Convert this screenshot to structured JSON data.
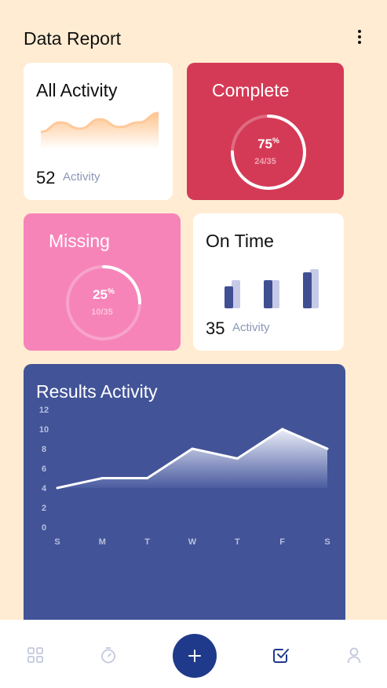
{
  "header": {
    "title": "Data Report",
    "menu_icon": "more-vertical-icon"
  },
  "all_activity": {
    "title": "All Activity",
    "count": "52",
    "count_label": "Activity",
    "sparkline": [
      0.3,
      0.6,
      0.4,
      0.7,
      0.45,
      0.6,
      0.9
    ]
  },
  "complete": {
    "title": "Complete",
    "percent": "75",
    "percent_sign": "%",
    "fraction": "24/35",
    "progress": 0.75,
    "color": "#d43a56"
  },
  "missing": {
    "title": "Missing",
    "percent": "25",
    "percent_sign": "%",
    "fraction": "10/35",
    "progress": 0.25,
    "color": "#f684b9"
  },
  "on_time": {
    "title": "On Time",
    "count": "35",
    "count_label": "Activity",
    "bars": [
      {
        "dark": 0.5,
        "light": 0.64
      },
      {
        "dark": 0.64,
        "light": 0.64
      },
      {
        "dark": 0.82,
        "light": 0.89
      }
    ]
  },
  "results": {
    "title": "Results Activity",
    "chart_data": {
      "type": "area",
      "title": "Results Activity",
      "categories": [
        "S",
        "M",
        "T",
        "W",
        "T",
        "F",
        "S"
      ],
      "values": [
        4,
        5,
        5,
        8,
        7,
        10,
        8
      ],
      "yticks": [
        12,
        10,
        8,
        6,
        4,
        2,
        0
      ],
      "ylim": [
        0,
        12
      ]
    }
  },
  "nav": {
    "items": [
      "grid-icon",
      "timer-icon",
      "add-icon",
      "checkbox-icon",
      "profile-icon"
    ]
  },
  "colors": {
    "background": "#ffecd2",
    "accent": "#1f3a8a",
    "chart_bg": "#425398"
  }
}
